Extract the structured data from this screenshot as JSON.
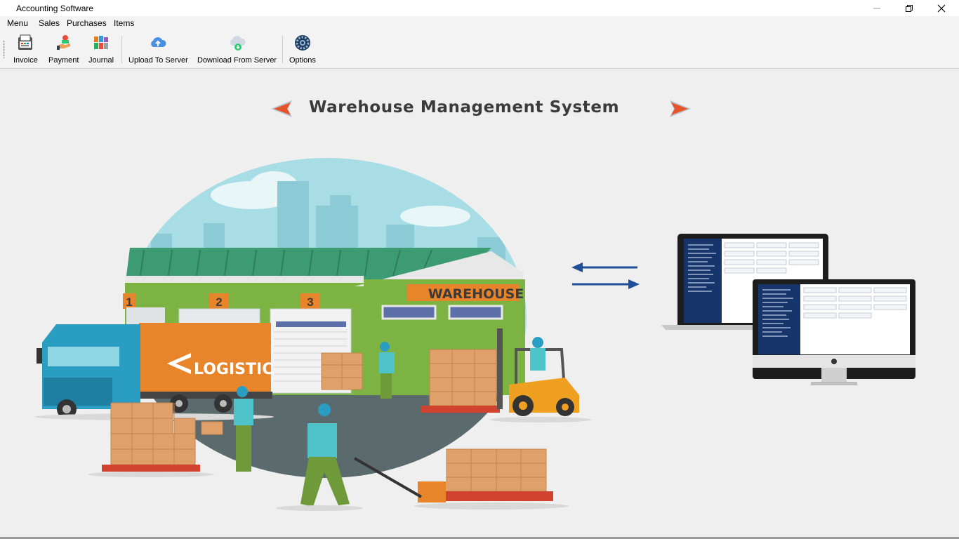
{
  "window": {
    "title": "Accounting Software"
  },
  "menu": {
    "items": [
      "Menu",
      "Sales",
      "Purchases",
      "Items"
    ]
  },
  "toolbar": {
    "buttons": [
      {
        "label": "Invoice",
        "icon": "invoice-icon"
      },
      {
        "label": "Payment",
        "icon": "payment-icon"
      },
      {
        "label": "Journal",
        "icon": "journal-icon"
      },
      {
        "label": "Upload To Server",
        "icon": "cloud-upload-icon"
      },
      {
        "label": "Download From Server",
        "icon": "cloud-download-icon"
      },
      {
        "label": "Options",
        "icon": "gear-icon"
      }
    ]
  },
  "banner": {
    "heading": "Warehouse Management System",
    "building_sign": "WAREHOUSE",
    "dock_numbers": [
      "1",
      "2",
      "3"
    ],
    "truck_label": "LOGISTIC"
  },
  "colors": {
    "accent_orange": "#e8842a",
    "sky": "#a9dde6",
    "roof_green": "#3d9b74",
    "wall_green": "#7cb342",
    "truck_teal": "#2a9ec2",
    "arrow_blue": "#1f4e9a",
    "sidebar_blue": "#17356b"
  }
}
